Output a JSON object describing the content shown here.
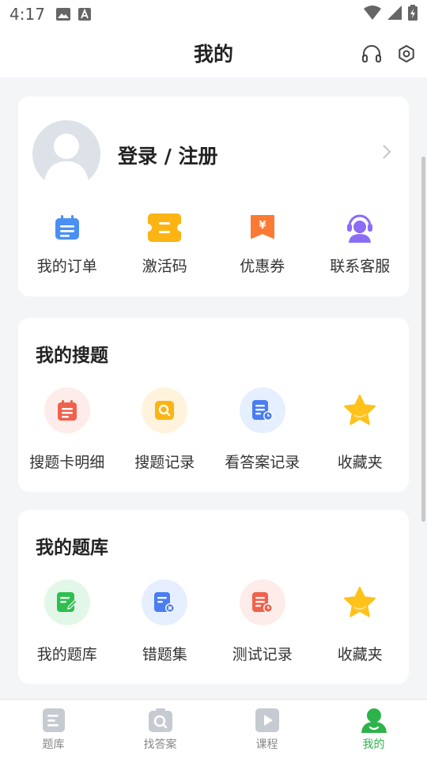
{
  "status_bar": {
    "time": "4:17"
  },
  "header": {
    "title": "我的"
  },
  "profile": {
    "login_label": "登录 / 注册",
    "actions": [
      {
        "label": "我的订单",
        "icon": "order-icon"
      },
      {
        "label": "激活码",
        "icon": "ticket-icon"
      },
      {
        "label": "优惠券",
        "icon": "coupon-icon"
      },
      {
        "label": "联系客服",
        "icon": "customer-service-icon"
      }
    ]
  },
  "my_search": {
    "title": "我的搜题",
    "items": [
      {
        "label": "搜题卡明细",
        "icon": "search-card-icon"
      },
      {
        "label": "搜题记录",
        "icon": "search-record-icon"
      },
      {
        "label": "看答案记录",
        "icon": "answer-record-icon"
      },
      {
        "label": "收藏夹",
        "icon": "star-icon"
      }
    ]
  },
  "my_bank": {
    "title": "我的题库",
    "items": [
      {
        "label": "我的题库",
        "icon": "question-bank-icon"
      },
      {
        "label": "错题集",
        "icon": "wrong-questions-icon"
      },
      {
        "label": "测试记录",
        "icon": "test-record-icon"
      },
      {
        "label": "收藏夹",
        "icon": "star-icon"
      }
    ]
  },
  "tabbar": {
    "active": "我的",
    "tabs": [
      {
        "label": "题库",
        "icon": "question-bank-tab-icon"
      },
      {
        "label": "找答案",
        "icon": "find-answer-tab-icon"
      },
      {
        "label": "课程",
        "icon": "course-tab-icon"
      },
      {
        "label": "我的",
        "icon": "profile-tab-icon"
      }
    ]
  },
  "colors": {
    "accent_green": "#2db34a",
    "background": "#f4f5f7",
    "card": "#ffffff",
    "inactive_tab": "#c6cad1"
  }
}
